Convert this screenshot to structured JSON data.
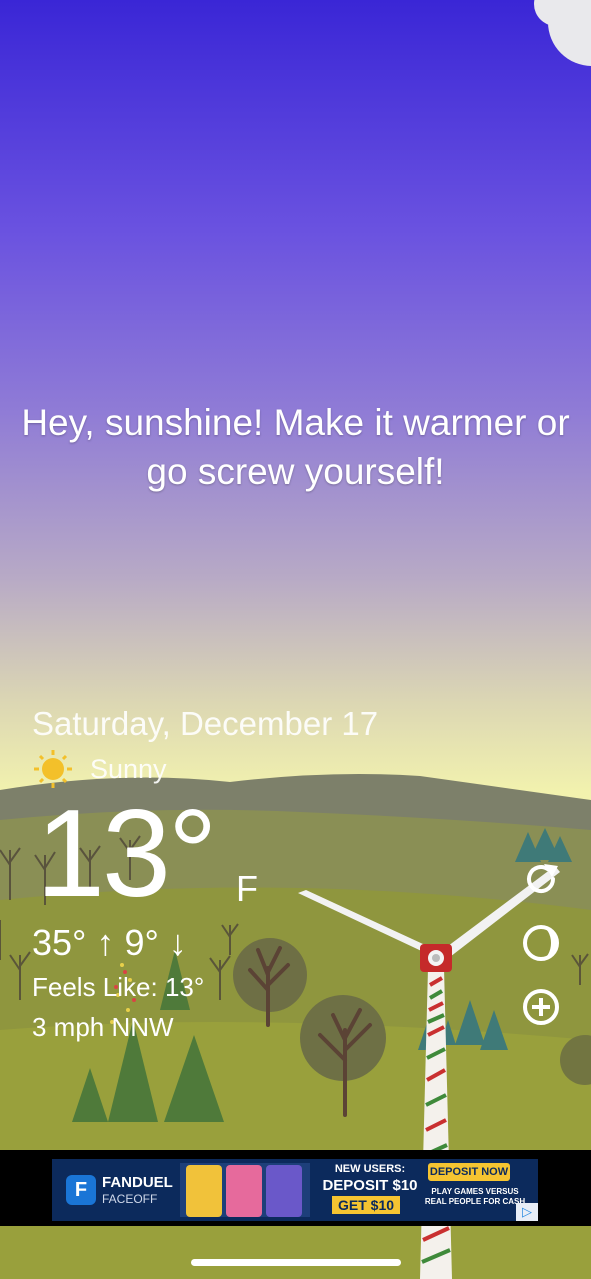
{
  "message": "Hey, sunshine! Make it warmer or go screw yourself!",
  "date": "Saturday, December 17",
  "condition": "Sunny",
  "condition_icon": "sun-icon",
  "temperature": "13°",
  "unit": "F",
  "hi_lo": "35° ↑ 9° ↓",
  "feels_like": "Feels Like: 13°",
  "wind": "3 mph NNW",
  "controls": [
    "refresh-icon",
    "moon-phase-icon",
    "add-icon"
  ],
  "ad": {
    "brand": "FANDUEL",
    "product": "FACEOFF",
    "headline": "NEW USERS:",
    "offer": "DEPOSIT $10",
    "offer2": "GET $10",
    "cta": "DEPOSIT NOW",
    "tagline": "PLAY GAMES VERSUS REAL PEOPLE FOR CASH",
    "tagline_1": "PLAY GAMES VERSUS",
    "tagline_2": "REAL PEOPLE FOR CASH"
  }
}
